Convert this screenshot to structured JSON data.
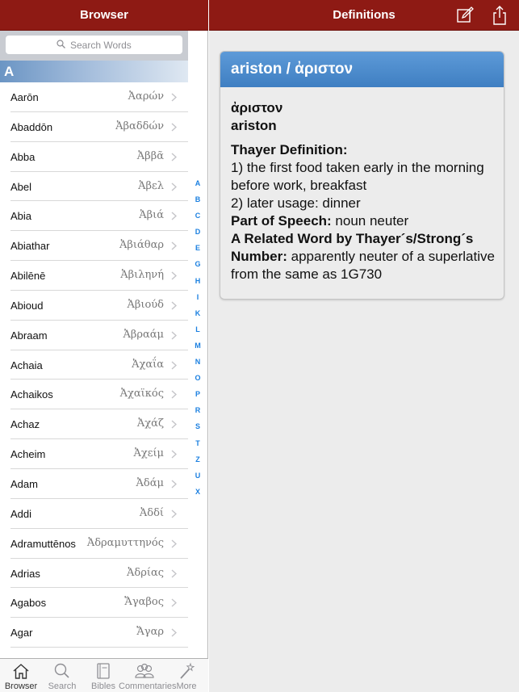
{
  "left_nav": {
    "title": "Browser"
  },
  "search": {
    "placeholder": "Search Words"
  },
  "section": {
    "letter": "A"
  },
  "words": [
    {
      "en": "Aarōn",
      "gr": "Ἀαρών"
    },
    {
      "en": "Abaddōn",
      "gr": "Ἀβαδδών"
    },
    {
      "en": "Abba",
      "gr": "Ἀββᾶ"
    },
    {
      "en": "Abel",
      "gr": "Ἀβελ"
    },
    {
      "en": "Abia",
      "gr": "Ἀβιά"
    },
    {
      "en": "Abiathar",
      "gr": "Ἀβιάθαρ"
    },
    {
      "en": "Abilēnē",
      "gr": "Ἀβιληνή"
    },
    {
      "en": "Abioud",
      "gr": "Ἀβιούδ"
    },
    {
      "en": "Abraam",
      "gr": "Ἀβραάμ"
    },
    {
      "en": "Achaia",
      "gr": "Ἀχαΐα"
    },
    {
      "en": "Achaikos",
      "gr": "Ἀχαϊκός"
    },
    {
      "en": "Achaz",
      "gr": "Ἀχάζ"
    },
    {
      "en": "Acheim",
      "gr": "Ἀχείμ"
    },
    {
      "en": "Adam",
      "gr": "Ἀδάμ"
    },
    {
      "en": "Addi",
      "gr": "Ἀδδί"
    },
    {
      "en": "Adramuttēnos",
      "gr": "Ἀδραμυττηνός"
    },
    {
      "en": "Adrias",
      "gr": "Ἀδρίας"
    },
    {
      "en": "Agabos",
      "gr": "Ἄγαβος"
    },
    {
      "en": "Agar",
      "gr": "Ἄγαρ"
    }
  ],
  "index_letters": [
    "A",
    "B",
    "C",
    "D",
    "E",
    "G",
    "H",
    "I",
    "K",
    "L",
    "M",
    "N",
    "O",
    "P",
    "R",
    "S",
    "T",
    "Z",
    "U",
    "X"
  ],
  "tabs": [
    {
      "label": "Browser",
      "icon": "home-icon"
    },
    {
      "label": "Search",
      "icon": "search-icon"
    },
    {
      "label": "Bibles",
      "icon": "book-icon"
    },
    {
      "label": "Commentaries",
      "icon": "people-icon"
    },
    {
      "label": "More",
      "icon": "magic-wand-icon"
    }
  ],
  "right_nav": {
    "title": "Definitions"
  },
  "definition": {
    "header": "ariston / ἀριστον",
    "greek": "ἀριστον",
    "translit": "ariston",
    "thayer_label": "Thayer Definition:",
    "def1": "1) the first food taken early in the morning before work, breakfast",
    "def2": "2) later usage: dinner",
    "pos_label": "Part of Speech:",
    "pos_value": " noun neuter",
    "related_label": "A Related Word by Thayer´s/Strong´s Number:",
    "related_value": " apparently neuter of a superlative from the same as 1G730"
  },
  "colors": {
    "nav_bar": "#8e1a14",
    "accent": "#1a7fe0",
    "card_header": "#4a88c8"
  }
}
